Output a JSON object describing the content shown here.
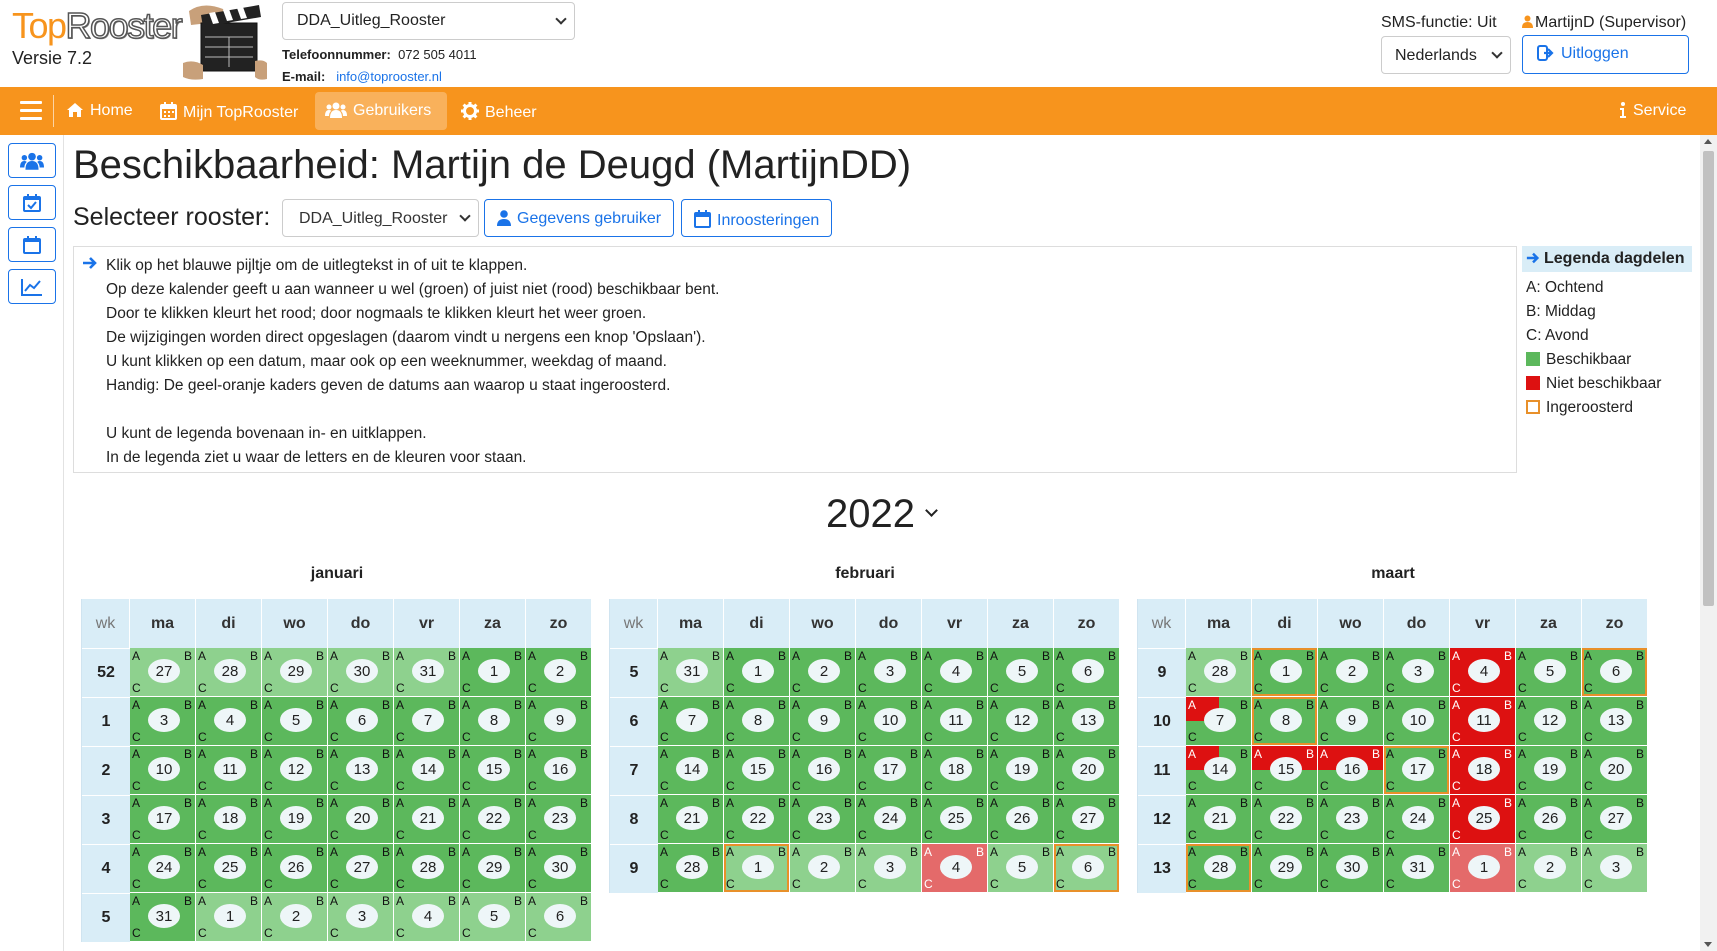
{
  "app": {
    "logo_top": "Top",
    "logo_rooster": "Rooster",
    "version": "Versie 7.2",
    "roster_select": "DDA_Uitleg_Rooster",
    "phone_label": "Telefoonnummer:",
    "phone": "072 505 4011",
    "email_label": "E-mail:",
    "email": "info@toprooster.nl",
    "sms": "SMS-functie: Uit",
    "user": "MartijnD (Supervisor)",
    "language": "Nederlands",
    "logout": "Uitloggen"
  },
  "nav": {
    "home": "Home",
    "mijn": "Mijn TopRooster",
    "gebruikers": "Gebruikers",
    "beheer": "Beheer",
    "service": "Service"
  },
  "page": {
    "title": "Beschikbaarheid: Martijn de Deugd (MartijnDD)",
    "select_label": "Selecteer rooster:",
    "select_value": "DDA_Uitleg_Rooster",
    "btn_user": "Gegevens gebruiker",
    "btn_schedule": "Inroosteringen",
    "info_lines": [
      "Klik op het blauwe pijltje om de uitlegtekst in of uit te klappen.",
      "Op deze kalender geeft u aan wanneer u wel (groen) of juist niet (rood) beschikbaar bent.",
      "Door te klikken kleurt het rood; door nogmaals te klikken kleurt het weer groen.",
      "De wijzigingen worden direct opgeslagen (daarom vindt u nergens een knop 'Opslaan').",
      "U kunt klikken op een datum, maar ook op een weeknummer, weekdag of maand.",
      "Handig: De geel-oranje kaders geven de datums aan waarop u staat ingeroosterd.",
      "",
      "U kunt de legenda bovenaan in- en uitklappen.",
      "In de legenda ziet u waar de letters en de kleuren voor staan."
    ],
    "year": "2022"
  },
  "legend": {
    "title": "Legenda dagdelen",
    "a": "A: Ochtend",
    "b": "B: Middag",
    "c": "C: Avond",
    "available": "Beschikbaar",
    "unavailable": "Niet beschikbaar",
    "scheduled": "Ingeroosterd"
  },
  "colors": {
    "orange": "#f7941d",
    "green": "#5cb85c",
    "green_light": "#8ed18e",
    "red": "#dd1111",
    "red_light": "#e46a6a",
    "blue": "#1a73e8",
    "header_blue": "#d9edf7",
    "scheduled_border": "#e8902a"
  },
  "calendar": {
    "wk_label": "wk",
    "day_headers": [
      "ma",
      "di",
      "wo",
      "do",
      "vr",
      "za",
      "zo"
    ],
    "part_labels": [
      "A",
      "B",
      "C"
    ],
    "months": [
      {
        "name": "januari",
        "weeks": [
          {
            "wk": "52",
            "days": [
              {
                "d": "27",
                "o": 1
              },
              {
                "d": "28",
                "o": 1
              },
              {
                "d": "29",
                "o": 1
              },
              {
                "d": "30",
                "o": 1
              },
              {
                "d": "31",
                "o": 1
              },
              {
                "d": "1"
              },
              {
                "d": "2"
              }
            ]
          },
          {
            "wk": "1",
            "days": [
              {
                "d": "3"
              },
              {
                "d": "4"
              },
              {
                "d": "5"
              },
              {
                "d": "6"
              },
              {
                "d": "7"
              },
              {
                "d": "8"
              },
              {
                "d": "9"
              }
            ]
          },
          {
            "wk": "2",
            "days": [
              {
                "d": "10"
              },
              {
                "d": "11"
              },
              {
                "d": "12"
              },
              {
                "d": "13"
              },
              {
                "d": "14"
              },
              {
                "d": "15"
              },
              {
                "d": "16"
              }
            ]
          },
          {
            "wk": "3",
            "days": [
              {
                "d": "17"
              },
              {
                "d": "18"
              },
              {
                "d": "19"
              },
              {
                "d": "20"
              },
              {
                "d": "21"
              },
              {
                "d": "22"
              },
              {
                "d": "23"
              }
            ]
          },
          {
            "wk": "4",
            "days": [
              {
                "d": "24"
              },
              {
                "d": "25"
              },
              {
                "d": "26"
              },
              {
                "d": "27"
              },
              {
                "d": "28"
              },
              {
                "d": "29"
              },
              {
                "d": "30"
              }
            ]
          },
          {
            "wk": "5",
            "days": [
              {
                "d": "31"
              },
              {
                "d": "1",
                "o": 1
              },
              {
                "d": "2",
                "o": 1
              },
              {
                "d": "3",
                "o": 1
              },
              {
                "d": "4",
                "o": 1
              },
              {
                "d": "5",
                "o": 1
              },
              {
                "d": "6",
                "o": 1
              }
            ]
          }
        ]
      },
      {
        "name": "februari",
        "weeks": [
          {
            "wk": "5",
            "days": [
              {
                "d": "31",
                "o": 1
              },
              {
                "d": "1"
              },
              {
                "d": "2"
              },
              {
                "d": "3"
              },
              {
                "d": "4"
              },
              {
                "d": "5"
              },
              {
                "d": "6"
              }
            ]
          },
          {
            "wk": "6",
            "days": [
              {
                "d": "7"
              },
              {
                "d": "8"
              },
              {
                "d": "9"
              },
              {
                "d": "10"
              },
              {
                "d": "11"
              },
              {
                "d": "12"
              },
              {
                "d": "13"
              }
            ]
          },
          {
            "wk": "7",
            "days": [
              {
                "d": "14"
              },
              {
                "d": "15"
              },
              {
                "d": "16"
              },
              {
                "d": "17"
              },
              {
                "d": "18"
              },
              {
                "d": "19"
              },
              {
                "d": "20"
              }
            ]
          },
          {
            "wk": "8",
            "days": [
              {
                "d": "21"
              },
              {
                "d": "22"
              },
              {
                "d": "23"
              },
              {
                "d": "24"
              },
              {
                "d": "25"
              },
              {
                "d": "26"
              },
              {
                "d": "27"
              }
            ]
          },
          {
            "wk": "9",
            "days": [
              {
                "d": "28"
              },
              {
                "d": "1",
                "o": 1,
                "s": 1
              },
              {
                "d": "2",
                "o": 1
              },
              {
                "d": "3",
                "o": 1
              },
              {
                "d": "4",
                "o": 1,
                "r": 1
              },
              {
                "d": "5",
                "o": 1
              },
              {
                "d": "6",
                "o": 1,
                "s": 1
              }
            ]
          }
        ]
      },
      {
        "name": "maart",
        "weeks": [
          {
            "wk": "9",
            "days": [
              {
                "d": "28",
                "o": 1
              },
              {
                "d": "1",
                "s": 1
              },
              {
                "d": "2"
              },
              {
                "d": "3"
              },
              {
                "d": "4",
                "r": 1
              },
              {
                "d": "5"
              },
              {
                "d": "6",
                "s": 1
              }
            ]
          },
          {
            "wk": "10",
            "days": [
              {
                "d": "7",
                "ra": 1
              },
              {
                "d": "8",
                "s": 1
              },
              {
                "d": "9"
              },
              {
                "d": "10"
              },
              {
                "d": "11",
                "r": 1
              },
              {
                "d": "12"
              },
              {
                "d": "13"
              }
            ]
          },
          {
            "wk": "11",
            "days": [
              {
                "d": "14",
                "ra": 1
              },
              {
                "d": "15",
                "ra": 1,
                "rb": 1
              },
              {
                "d": "16",
                "ra": 1,
                "rb": 1
              },
              {
                "d": "17",
                "s": 1
              },
              {
                "d": "18",
                "r": 1
              },
              {
                "d": "19"
              },
              {
                "d": "20"
              }
            ]
          },
          {
            "wk": "12",
            "days": [
              {
                "d": "21"
              },
              {
                "d": "22"
              },
              {
                "d": "23"
              },
              {
                "d": "24"
              },
              {
                "d": "25",
                "r": 1
              },
              {
                "d": "26"
              },
              {
                "d": "27"
              }
            ]
          },
          {
            "wk": "13",
            "days": [
              {
                "d": "28",
                "s": 1
              },
              {
                "d": "29"
              },
              {
                "d": "30"
              },
              {
                "d": "31"
              },
              {
                "d": "1",
                "o": 1,
                "r": 1
              },
              {
                "d": "2",
                "o": 1
              },
              {
                "d": "3",
                "o": 1
              }
            ]
          }
        ]
      }
    ]
  }
}
